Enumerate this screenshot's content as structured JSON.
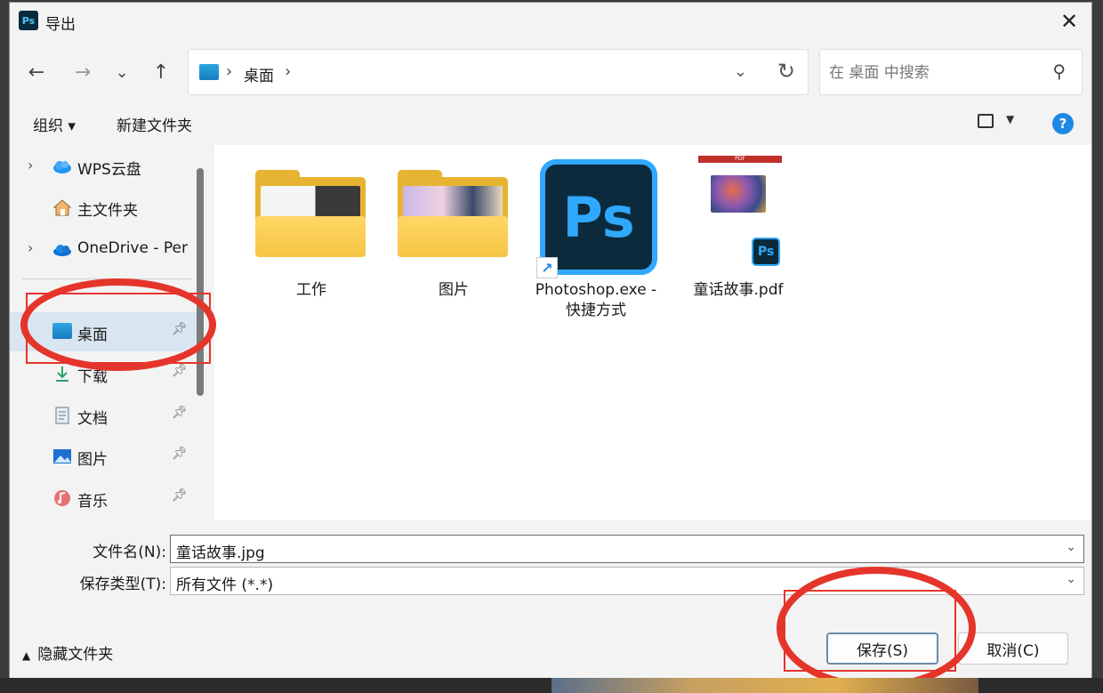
{
  "window": {
    "app_icon": "Ps",
    "title": "导出",
    "close": "✕"
  },
  "nav": {
    "back": "←",
    "forward": "→",
    "recent": "⌄",
    "up": "↑"
  },
  "address": {
    "path": [
      "桌面"
    ],
    "separator": "›",
    "dropdown": "⌄",
    "refresh": "↻"
  },
  "search": {
    "placeholder": "在 桌面 中搜索",
    "icon": "⚲"
  },
  "toolbar": {
    "organize": "组织 ▾",
    "new_folder": "新建文件夹",
    "help": "?"
  },
  "sidebar": {
    "items": [
      {
        "label": "WPS云盘",
        "icon": "cloud-icon",
        "expandable": true
      },
      {
        "label": "主文件夹",
        "icon": "home-icon",
        "expandable": false
      },
      {
        "label": "OneDrive - Per",
        "icon": "cloud-icon",
        "expandable": true
      },
      {
        "label": "桌面",
        "icon": "desktop-icon",
        "pinned": true,
        "selected": true
      },
      {
        "label": "下载",
        "icon": "download-icon",
        "pinned": true
      },
      {
        "label": "文档",
        "icon": "document-icon",
        "pinned": true
      },
      {
        "label": "图片",
        "icon": "picture-icon",
        "pinned": true
      },
      {
        "label": "音乐",
        "icon": "music-icon",
        "pinned": true
      }
    ]
  },
  "files": [
    {
      "name": "工作",
      "type": "folder"
    },
    {
      "name": "图片",
      "type": "folder"
    },
    {
      "name": "Photoshop.exe - 快捷方式",
      "type": "shortcut",
      "icon_text": "Ps"
    },
    {
      "name": "童话故事.pdf",
      "type": "pdf",
      "badge": "Ps",
      "thumb_header": "PDF"
    }
  ],
  "form": {
    "filename_label": "文件名(N):",
    "filename_value": "童话故事.jpg",
    "filetype_label": "保存类型(T):",
    "filetype_value": "所有文件 (*.*)"
  },
  "footer": {
    "hide_folders": "隐藏文件夹",
    "save": "保存(S)",
    "cancel": "取消(C)"
  },
  "colors": {
    "annotation": "#e5352b",
    "selected": "#d9e6f2",
    "accent": "#1e88e5"
  }
}
